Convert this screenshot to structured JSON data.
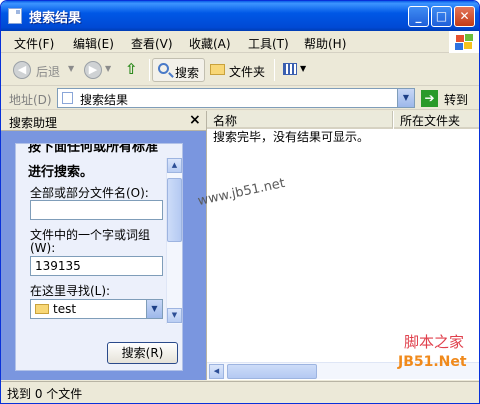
{
  "window": {
    "title": "搜索结果"
  },
  "menu": [
    "文件(F)",
    "编辑(E)",
    "查看(V)",
    "收藏(A)",
    "工具(T)",
    "帮助(H)"
  ],
  "toolbar": {
    "back": "后退",
    "search": "搜索",
    "folders": "文件夹"
  },
  "address": {
    "label": "地址(D)",
    "value": "搜索结果",
    "go": "转到"
  },
  "assistant": {
    "title": "搜索助理",
    "intro_line1": "按下面任何或所有标准",
    "intro_line2": "进行搜索。",
    "name_label": "全部或部分文件名(O):",
    "name_value": "",
    "word_label_1": "文件中的一个字或词组",
    "word_label_2": "(W):",
    "word_value": "139135",
    "look_in_label": "在这里寻找(L):",
    "look_in_value": "test",
    "search_button": "搜索(R)"
  },
  "results": {
    "columns": [
      "名称",
      "所在文件夹"
    ],
    "empty_message": "搜索完毕，没有结果可显示。"
  },
  "status": {
    "text": "找到 0 个文件"
  },
  "watermarks": {
    "center": "www.jb51.net",
    "corner_top": "脚本之家",
    "corner_bottom": "JB51.Net"
  }
}
